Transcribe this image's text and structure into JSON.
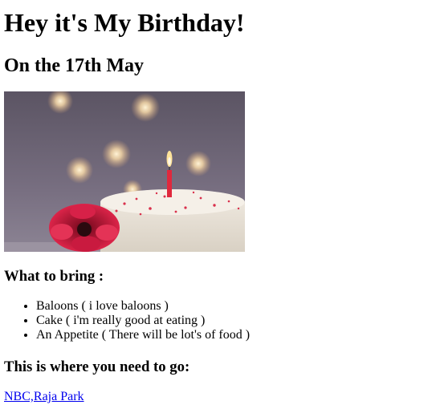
{
  "heading": "Hey it's My Birthday!",
  "date": "On the 17th May",
  "image": {
    "subject": "birthday-cake-with-candle",
    "colors": {
      "background": "#6f6678",
      "frosting": "#ece6dc",
      "flower": "#d0173a",
      "candle": "#e0283d",
      "flame": "#ffd777"
    }
  },
  "bring": {
    "title": "What to bring :",
    "items": [
      "Baloons ( i love baloons )",
      "Cake ( i'm really good at eating )",
      "An Appetite ( There will be lot's of food )"
    ]
  },
  "location": {
    "title": "This is where you need to go:",
    "link": "NBC,Raja Park"
  },
  "colors": {
    "link": "#0000ee",
    "text": "#000000"
  }
}
